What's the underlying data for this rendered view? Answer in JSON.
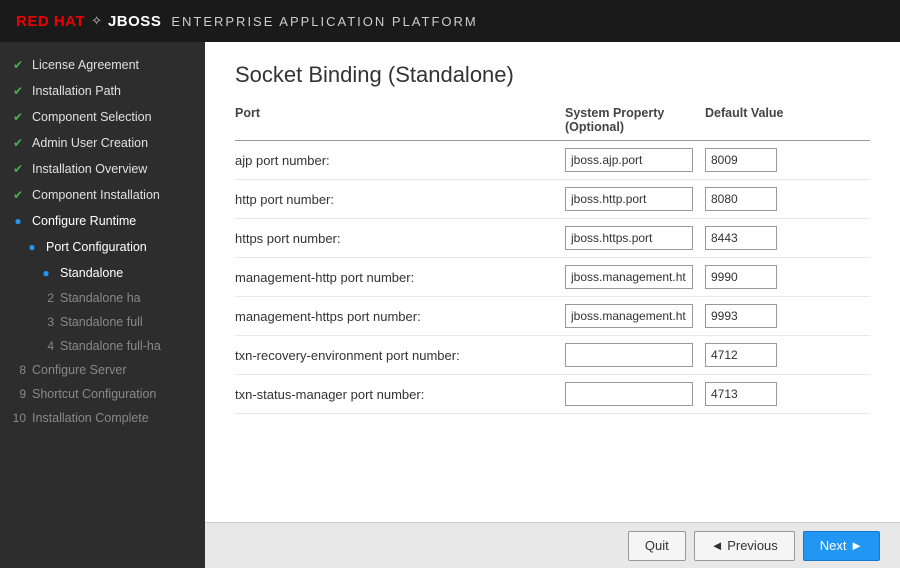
{
  "header": {
    "red_hat": "RED HAT",
    "jboss": "JBOSS",
    "app_title": "ENTERPRISE APPLICATION PLATFORM"
  },
  "sidebar": {
    "items": [
      {
        "id": "license",
        "label": "License Agreement",
        "icon": "check",
        "indent": 0
      },
      {
        "id": "install-path",
        "label": "Installation Path",
        "icon": "check",
        "indent": 0
      },
      {
        "id": "component-sel",
        "label": "Component Selection",
        "icon": "check",
        "indent": 0
      },
      {
        "id": "admin-user",
        "label": "Admin User Creation",
        "icon": "check",
        "indent": 0
      },
      {
        "id": "install-overview",
        "label": "Installation Overview",
        "icon": "check",
        "indent": 0
      },
      {
        "id": "component-install",
        "label": "Component Installation",
        "icon": "check",
        "indent": 0
      },
      {
        "id": "configure-runtime",
        "label": "Configure Runtime",
        "icon": "circle-active",
        "indent": 0
      },
      {
        "id": "port-config",
        "label": "Port Configuration",
        "icon": "circle-active",
        "indent": 1
      },
      {
        "id": "standalone",
        "label": "Standalone",
        "icon": "circle-sub",
        "indent": 2
      },
      {
        "id": "standalone-ha",
        "label": "Standalone ha",
        "icon": "none",
        "indent": 2,
        "num": "2"
      },
      {
        "id": "standalone-full",
        "label": "Standalone full",
        "icon": "none",
        "indent": 2,
        "num": "3"
      },
      {
        "id": "standalone-full-ha",
        "label": "Standalone full-ha",
        "icon": "none",
        "indent": 2,
        "num": "4"
      },
      {
        "id": "configure-server",
        "label": "Configure Server",
        "icon": "none",
        "indent": 0,
        "num": "8"
      },
      {
        "id": "shortcut-config",
        "label": "Shortcut Configuration",
        "icon": "none",
        "indent": 0,
        "num": "9"
      },
      {
        "id": "install-complete",
        "label": "Installation Complete",
        "icon": "none",
        "indent": 0,
        "num": "10"
      }
    ]
  },
  "main": {
    "title": "Socket Binding (Standalone)",
    "table": {
      "col_port": "Port",
      "col_sysprop": "System Property\n(Optional)",
      "col_default": "Default Value"
    },
    "ports": [
      {
        "label": "ajp port number:",
        "sysprop": "jboss.ajp.port",
        "default": "8009"
      },
      {
        "label": "http port number:",
        "sysprop": "jboss.http.port",
        "default": "8080"
      },
      {
        "label": "https port number:",
        "sysprop": "jboss.https.port",
        "default": "8443"
      },
      {
        "label": "management-http port number:",
        "sysprop": "jboss.management.ht",
        "default": "9990"
      },
      {
        "label": "management-https port number:",
        "sysprop": "jboss.management.ht",
        "default": "9993"
      },
      {
        "label": "txn-recovery-environment port number:",
        "sysprop": "",
        "default": "4712"
      },
      {
        "label": "txn-status-manager port number:",
        "sysprop": "",
        "default": "4713"
      }
    ]
  },
  "footer": {
    "quit_label": "Quit",
    "prev_label": "◄ Previous",
    "next_label": "Next ►"
  }
}
